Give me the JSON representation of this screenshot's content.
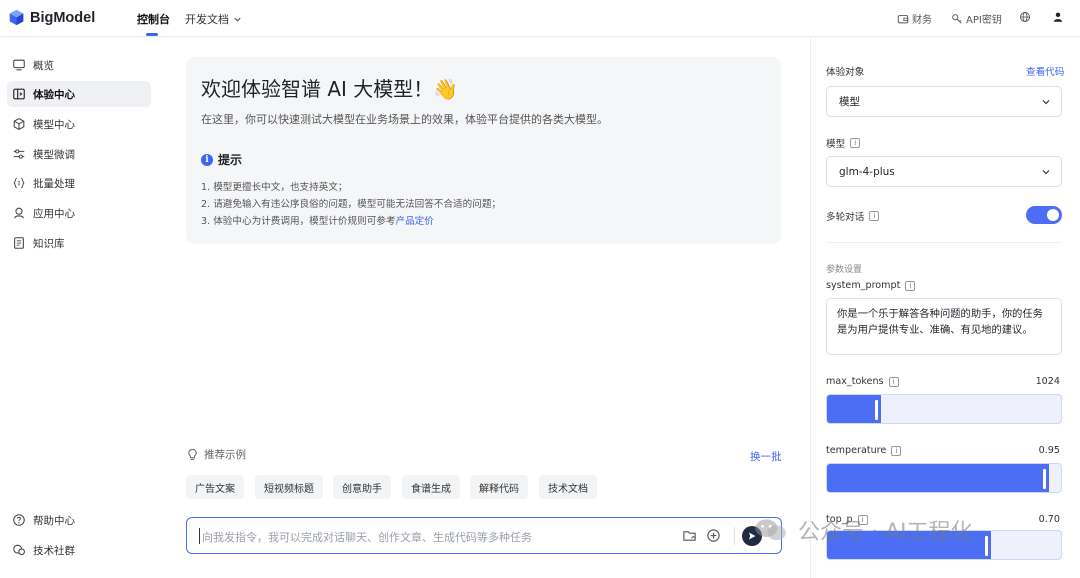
{
  "app": {
    "brand": "BigModel",
    "nav": [
      "控制台",
      "开发文档"
    ],
    "top_links": [
      "财务",
      "API密钥"
    ]
  },
  "sidebar": {
    "items": [
      {
        "label": "概览",
        "icon": "monitor-icon"
      },
      {
        "label": "体验中心",
        "icon": "experience-icon",
        "active": true
      },
      {
        "label": "模型中心",
        "icon": "cube-icon"
      },
      {
        "label": "模型微调",
        "icon": "sliders-icon"
      },
      {
        "label": "批量处理",
        "icon": "braces-icon"
      },
      {
        "label": "应用中心",
        "icon": "app-icon"
      },
      {
        "label": "知识库",
        "icon": "book-icon"
      }
    ],
    "bottom": [
      {
        "label": "帮助中心",
        "icon": "help-icon"
      },
      {
        "label": "技术社群",
        "icon": "community-icon"
      }
    ]
  },
  "welcome": {
    "title": "欢迎体验智谱 AI 大模型！👋",
    "subtitle": "在这里，你可以快速测试大模型在业务场景上的效果，体验平台提供的各类大模型。",
    "tip_title": "提示",
    "tips": [
      "1. 模型更擅长中文，也支持英文；",
      "2. 请避免输入有违公序良俗的问题，模型可能无法回答不合适的问题；"
    ],
    "tip3_prefix": "3. 体验中心为计费调用，模型计价规则可参考",
    "tip3_link": "产品定价"
  },
  "recommend": {
    "title": "推荐示例",
    "refresh": "换一批",
    "chips": [
      "广告文案",
      "短视频标题",
      "创意助手",
      "食谱生成",
      "解释代码",
      "技术文档"
    ]
  },
  "chat": {
    "placeholder": "向我发指令，我可以完成对话聊天、创作文章、生成代码等多种任务"
  },
  "panel": {
    "target_label": "体验对象",
    "view_code": "查看代码",
    "target_value": "模型",
    "model_label": "模型",
    "model_value": "glm-4-plus",
    "multi_turn_label": "多轮对话",
    "multi_turn_on": true,
    "params_title": "参数设置",
    "system_prompt_label": "system_prompt",
    "system_prompt_value": "你是一个乐于解答各种问题的助手，你的任务是为用户提供专业、准确、有见地的建议。",
    "params": [
      {
        "name": "max_tokens",
        "value": "1024",
        "fraction": 0.23
      },
      {
        "name": "temperature",
        "value": "0.95",
        "fraction": 0.95
      },
      {
        "name": "top_p",
        "value": "0.70",
        "fraction": 0.7
      }
    ]
  },
  "watermark": {
    "text": "公众号 · AI工程化"
  },
  "colors": {
    "accent": "#4b6ef5",
    "link": "#3d64f2"
  }
}
